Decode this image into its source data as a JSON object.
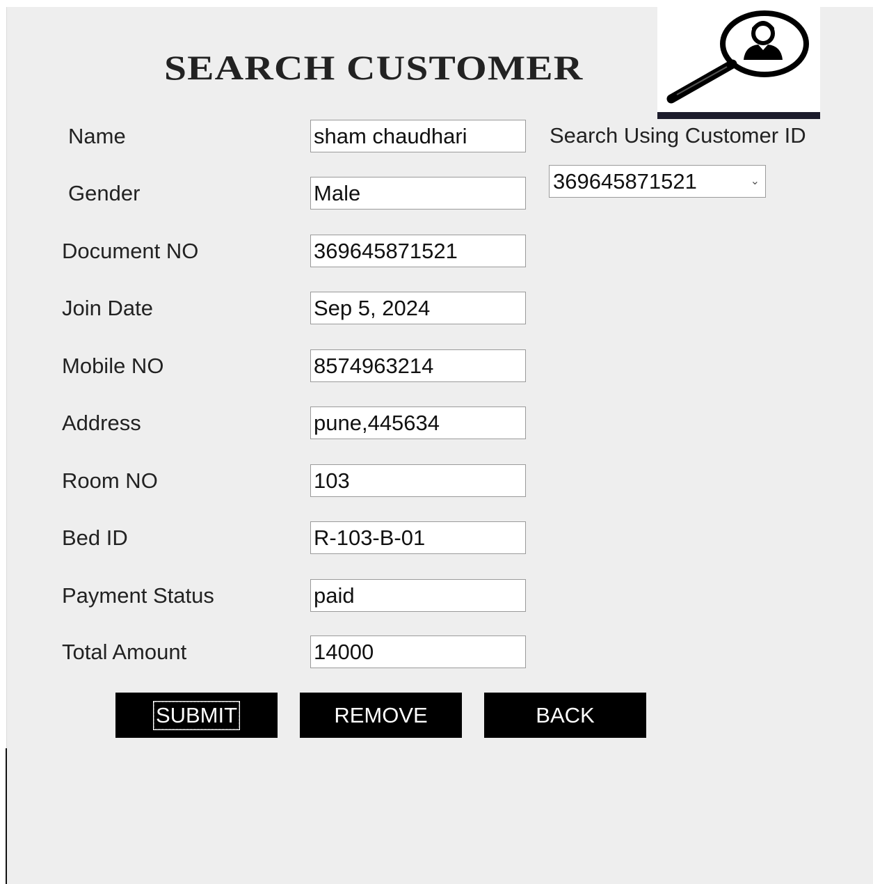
{
  "page": {
    "title": "SEARCH CUSTOMER"
  },
  "form": {
    "fields": [
      {
        "label": "Name",
        "value": "sham chaudhari"
      },
      {
        "label": "Gender",
        "value": "Male"
      },
      {
        "label": "Document NO",
        "value": "369645871521"
      },
      {
        "label": "Join Date",
        "value": "Sep 5, 2024"
      },
      {
        "label": "Mobile NO",
        "value": "8574963214"
      },
      {
        "label": "Address",
        "value": "pune,445634"
      },
      {
        "label": "Room NO",
        "value": "103"
      },
      {
        "label": "Bed ID",
        "value": "R-103-B-01"
      },
      {
        "label": "Payment Status",
        "value": "paid"
      },
      {
        "label": "Total Amount",
        "value": "14000"
      }
    ]
  },
  "search": {
    "label": "Search Using Customer ID",
    "selected": "369645871521"
  },
  "buttons": {
    "submit": "SUBMIT",
    "remove": "REMOVE",
    "back": "BACK"
  },
  "icons": {
    "logo": "magnifier-person-icon",
    "dropdown": "chevron-down-icon"
  },
  "colors": {
    "background": "#eeeeee",
    "button": "#000000",
    "button_text": "#ffffff"
  }
}
